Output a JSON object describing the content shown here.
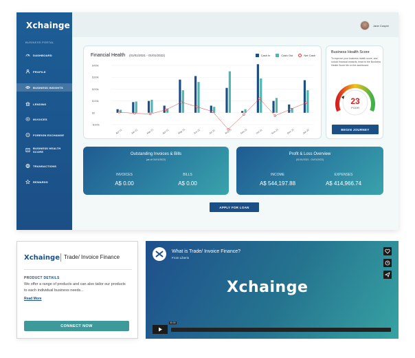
{
  "app": {
    "logo": "Xchainge",
    "portal_label": "BUSINESS PORTAL",
    "user_name": "Jane Cooper"
  },
  "colors": {
    "brand_dark": "#1b4f86",
    "teal": "#4fb6b0",
    "net_cash": "#e23b3b",
    "gauge_red": "#d62020"
  },
  "sidebar": {
    "items": [
      {
        "label": "DASHBOARD",
        "icon": "gauge-icon",
        "active": false
      },
      {
        "label": "PROFILE",
        "icon": "user-icon",
        "active": false
      },
      {
        "label": "BUSINESS INSIGHTS",
        "icon": "eye-icon",
        "active": true
      },
      {
        "label": "LENDING",
        "icon": "bank-icon",
        "active": false
      },
      {
        "label": "INVOICES",
        "icon": "invoice-icon",
        "active": false
      },
      {
        "label": "FOREIGN EXCHANGE",
        "icon": "exchange-icon",
        "active": false
      },
      {
        "label": "BUSINESS HEALTH SCORE",
        "icon": "scorecard-icon",
        "active": false
      },
      {
        "label": "TRANSACTIONS",
        "icon": "globe-icon",
        "active": false
      },
      {
        "label": "REWARDS",
        "icon": "star-icon",
        "active": false
      }
    ]
  },
  "financial_health": {
    "title": "Financial Health",
    "range": "(01/01/2021 - 01/01/2022)",
    "legend": {
      "cash_in": "Cash In",
      "cash_out": "Cash Out",
      "net_cash": "Net Cash"
    }
  },
  "chart_data": {
    "type": "bar",
    "categories": [
      "Apr 21",
      "Jan 21",
      "Mar 21",
      "Apr 21",
      "May 21",
      "Jun 21",
      "Jul 21",
      "Aug 21",
      "Sep 21",
      "Oct 21",
      "Nov 21",
      "Dec 21",
      "Jan 22"
    ],
    "y_ticks": [
      "$400k",
      "$300k",
      "$200k",
      "$100k",
      "$0",
      "-$100k"
    ],
    "ylim": [
      -100,
      400
    ],
    "series": [
      {
        "name": "Cash In",
        "values": [
          30,
          90,
          100,
          60,
          280,
          310,
          60,
          210,
          15,
          410,
          100,
          70,
          275
        ]
      },
      {
        "name": "Cash Out",
        "values": [
          25,
          95,
          110,
          35,
          190,
          260,
          50,
          350,
          30,
          290,
          125,
          40,
          190
        ]
      },
      {
        "name": "Net Cash",
        "values": [
          5,
          -5,
          -10,
          25,
          90,
          50,
          10,
          -140,
          -15,
          120,
          -25,
          30,
          85
        ]
      }
    ]
  },
  "health_score": {
    "title": "Business Health Score",
    "description": "To improve your business health score, and unlock financial rewards, head to the Business Health Score tile on the dashboard.",
    "score": "23",
    "score_label": "POOR",
    "score_value": 23,
    "button": "BEGIN JOURNEY"
  },
  "invoices_card": {
    "title": "Outstanding Invoices & Bills",
    "date": "(as of 01/01/2022)",
    "invoices_label": "INVOICES",
    "invoices_value": "A$ 0.00",
    "bills_label": "BILLS",
    "bills_value": "A$ 0.00"
  },
  "pnl_card": {
    "title": "Profit & Loss Overview",
    "date": "(01/01/2021 - 01/01/2022)",
    "income_label": "INCOME",
    "income_value": "A$ 544,197.88",
    "expenses_label": "EXPENSES",
    "expenses_value": "A$ 414,966.74"
  },
  "apply_button": "APPLY FOR LOAN",
  "product": {
    "logo": "Xchainge",
    "name": "Trade/ Invoice Finance",
    "details_heading": "PRODUCT DETAILS",
    "details_text": "We offer a range of products and can also tailor our products to each individual business needs...",
    "read_more": "Read More",
    "connect_button": "CONNECT NOW"
  },
  "video": {
    "title": "What is Trade/ Invoice Finance?",
    "from": "From Liberis",
    "logo": "Xchainge",
    "time": "00:00"
  }
}
